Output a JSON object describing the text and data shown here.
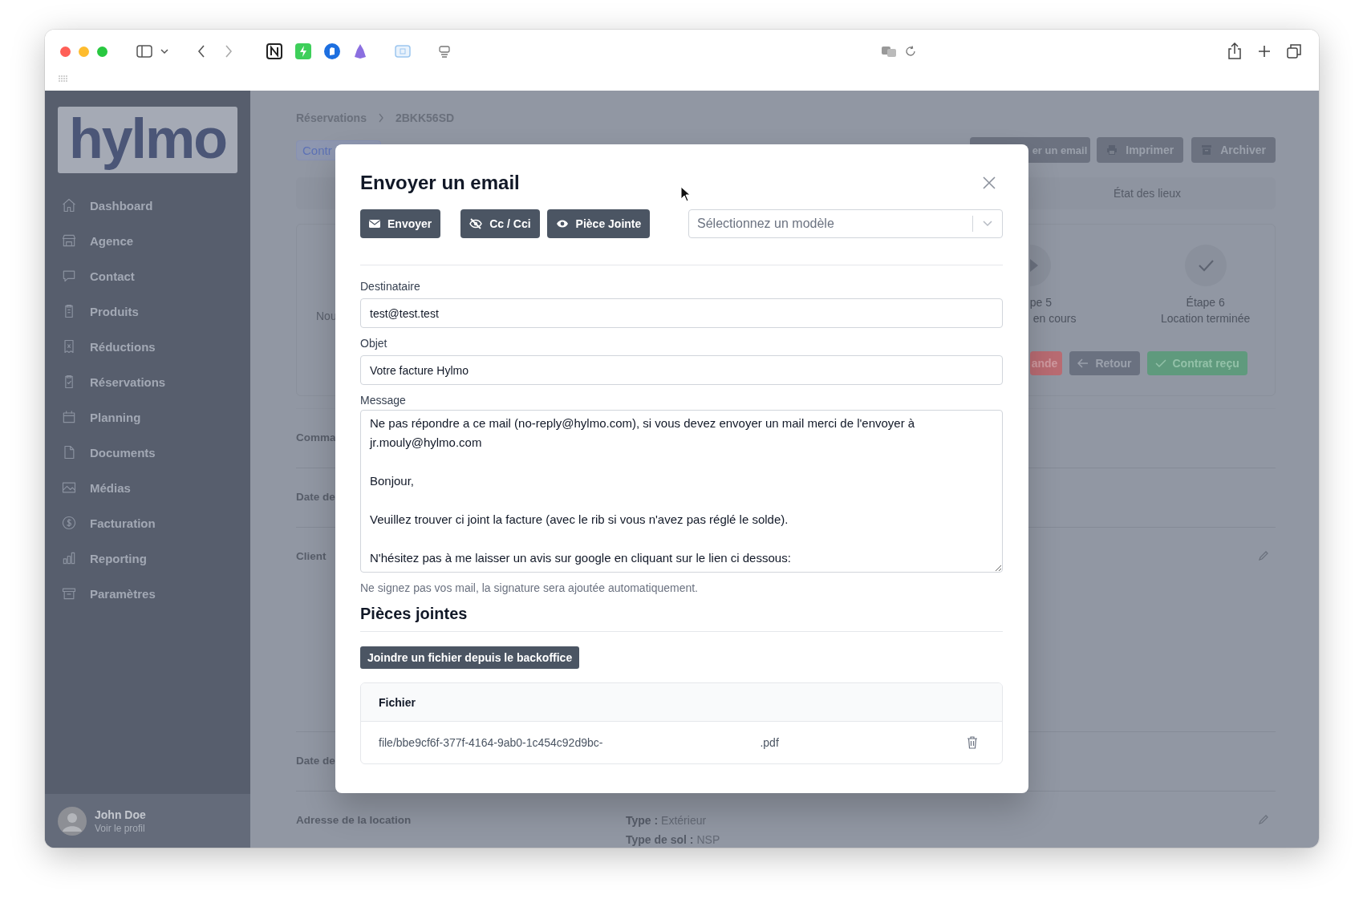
{
  "sidebar": {
    "logo": "hylmo",
    "items": [
      {
        "label": "Dashboard"
      },
      {
        "label": "Agence"
      },
      {
        "label": "Contact"
      },
      {
        "label": "Produits"
      },
      {
        "label": "Réductions"
      },
      {
        "label": "Réservations"
      },
      {
        "label": "Planning"
      },
      {
        "label": "Documents"
      },
      {
        "label": "Médias"
      },
      {
        "label": "Facturation"
      },
      {
        "label": "Reporting"
      },
      {
        "label": "Paramètres"
      }
    ],
    "user": {
      "name": "John Doe",
      "link": "Voir le profil"
    }
  },
  "page": {
    "breadcrumb": [
      "Réservations",
      "2BKK56SD"
    ],
    "tab": "Contr",
    "actions": [
      {
        "label": "er un email",
        "kind": "email"
      },
      {
        "label": "Imprimer",
        "kind": "print"
      },
      {
        "label": "Archiver",
        "kind": "archive"
      }
    ],
    "section_tab": "État des lieux",
    "card_text": "Nou",
    "steps": [
      {
        "title": "pe 5",
        "subtitle": "en cours",
        "kind": "current"
      },
      {
        "title": "Étape 6",
        "subtitle": "Location terminée",
        "kind": "done"
      }
    ],
    "step_buttons": [
      {
        "label": "ande",
        "kind": "danger"
      },
      {
        "label": "Retour",
        "kind": "back"
      },
      {
        "label": "Contrat reçu",
        "kind": "success"
      }
    ],
    "rows": [
      {
        "label": "Comma",
        "editable": false
      },
      {
        "label": "Date de",
        "editable": false
      },
      {
        "label": "Client",
        "editable": true
      },
      {
        "label": "Date de",
        "editable": false
      },
      {
        "label": "Adresse de la location",
        "editable": true,
        "details": [
          {
            "key": "Type :",
            "value": "Extérieur"
          },
          {
            "key": "Type de sol :",
            "value": "NSP"
          }
        ]
      }
    ]
  },
  "modal": {
    "title": "Envoyer un email",
    "buttons": [
      {
        "label": "Envoyer",
        "kind": "send"
      },
      {
        "label": "Cc / Cci",
        "kind": "cc"
      },
      {
        "label": "Pièce Jointe",
        "kind": "attach"
      }
    ],
    "template_select": {
      "placeholder": "Sélectionnez un modèle"
    },
    "fields": [
      {
        "label": "Destinataire",
        "value": "test@test.test"
      },
      {
        "label": "Objet",
        "value": "Votre facture Hylmo"
      }
    ],
    "message": {
      "label": "Message",
      "value": "Ne pas répondre a ce mail (no-reply@hylmo.com), si vous devez envoyer un mail merci de l'envoyer à jr.mouly@hylmo.com\n\nBonjour,\n\nVeuillez trouver ci joint la facture (avec le rib si vous n'avez pas réglé le solde).\n\nN'hésitez pas à me laisser un avis sur google en cliquant sur le lien ci dessous:"
    },
    "hint": "Ne signez pas vos mail, la signature sera ajoutée automatiquement.",
    "attachments": {
      "title": "Pièces jointes",
      "button": "Joindre un fichier depuis le backoffice",
      "column": "Fichier",
      "files": [
        {
          "name_start": "file/bbe9cf6f-377f-4164-9ab0-1c454c92d9bc-",
          "name_end": ".pdf"
        }
      ]
    }
  }
}
